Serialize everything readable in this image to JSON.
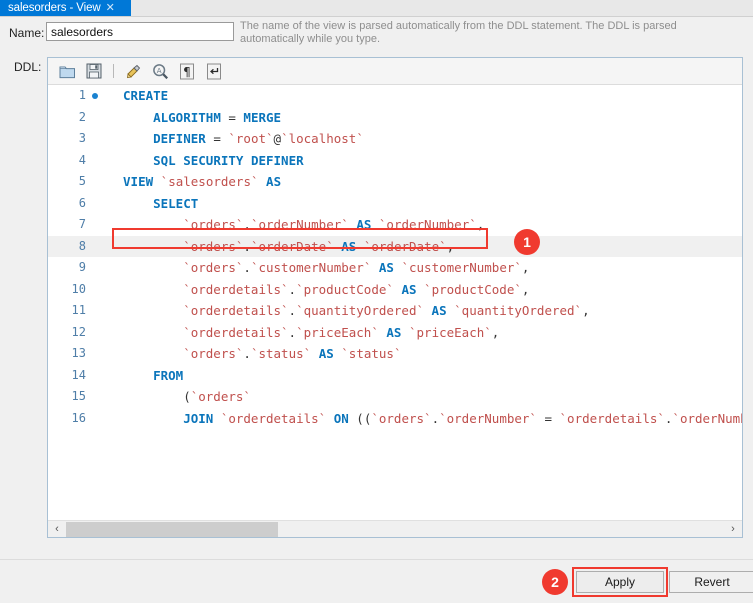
{
  "tab": {
    "label": "salesorders - View",
    "close_icon": "close-icon"
  },
  "name_row": {
    "label": "Name:",
    "value": "salesorders",
    "placeholder": "",
    "hint": "The name of the view is parsed automatically from the DDL statement. The DDL is parsed automatically while you type."
  },
  "ddl": {
    "label": "DDL:",
    "toolbar": [
      {
        "name": "open-folder-icon",
        "title": "Open"
      },
      {
        "name": "save-icon",
        "title": "Save"
      },
      {
        "name": "beautify-broom-icon",
        "title": "Beautify"
      },
      {
        "name": "find-icon",
        "title": "Find"
      },
      {
        "name": "show-invisible-chars-icon",
        "title": "Show Invisible Characters"
      },
      {
        "name": "toggle-wrapping-icon",
        "title": "Toggle Wrapping"
      }
    ],
    "highlighted_line": 8,
    "lines": [
      {
        "num": "1",
        "breakpoint": true,
        "indent": 2,
        "tokens": [
          {
            "t": "kw",
            "v": "CREATE"
          }
        ]
      },
      {
        "num": "2",
        "breakpoint": false,
        "indent": 6,
        "tokens": [
          {
            "t": "kw",
            "v": "ALGORITHM"
          },
          {
            "t": "pl",
            "v": " = "
          },
          {
            "t": "kw",
            "v": "MERGE"
          }
        ]
      },
      {
        "num": "3",
        "breakpoint": false,
        "indent": 6,
        "tokens": [
          {
            "t": "kw",
            "v": "DEFINER"
          },
          {
            "t": "pl",
            "v": " = "
          },
          {
            "t": "id",
            "v": "`root`"
          },
          {
            "t": "pl",
            "v": "@"
          },
          {
            "t": "id",
            "v": "`localhost`"
          }
        ]
      },
      {
        "num": "4",
        "breakpoint": false,
        "indent": 6,
        "tokens": [
          {
            "t": "kw",
            "v": "SQL SECURITY DEFINER"
          }
        ]
      },
      {
        "num": "5",
        "breakpoint": false,
        "indent": 2,
        "tokens": [
          {
            "t": "kw",
            "v": "VIEW"
          },
          {
            "t": "pl",
            "v": " "
          },
          {
            "t": "id",
            "v": "`salesorders`"
          },
          {
            "t": "pl",
            "v": " "
          },
          {
            "t": "kw",
            "v": "AS"
          }
        ]
      },
      {
        "num": "6",
        "breakpoint": false,
        "indent": 6,
        "tokens": [
          {
            "t": "kw",
            "v": "SELECT"
          }
        ]
      },
      {
        "num": "7",
        "breakpoint": false,
        "indent": 10,
        "tokens": [
          {
            "t": "id",
            "v": "`orders`"
          },
          {
            "t": "pl",
            "v": "."
          },
          {
            "t": "id",
            "v": "`orderNumber`"
          },
          {
            "t": "pl",
            "v": " "
          },
          {
            "t": "kw",
            "v": "AS"
          },
          {
            "t": "pl",
            "v": " "
          },
          {
            "t": "id",
            "v": "`orderNumber`"
          },
          {
            "t": "pl",
            "v": ","
          }
        ]
      },
      {
        "num": "8",
        "breakpoint": false,
        "indent": 10,
        "tokens": [
          {
            "t": "id",
            "v": "`orders`"
          },
          {
            "t": "pl",
            "v": "."
          },
          {
            "t": "id",
            "v": "`orderDate`"
          },
          {
            "t": "pl",
            "v": " "
          },
          {
            "t": "kw",
            "v": "AS"
          },
          {
            "t": "pl",
            "v": " "
          },
          {
            "t": "id",
            "v": "`orderDate`"
          },
          {
            "t": "pl",
            "v": ","
          }
        ]
      },
      {
        "num": "9",
        "breakpoint": false,
        "indent": 10,
        "tokens": [
          {
            "t": "id",
            "v": "`orders`"
          },
          {
            "t": "pl",
            "v": "."
          },
          {
            "t": "id",
            "v": "`customerNumber`"
          },
          {
            "t": "pl",
            "v": " "
          },
          {
            "t": "kw",
            "v": "AS"
          },
          {
            "t": "pl",
            "v": " "
          },
          {
            "t": "id",
            "v": "`customerNumber`"
          },
          {
            "t": "pl",
            "v": ","
          }
        ]
      },
      {
        "num": "10",
        "breakpoint": false,
        "indent": 10,
        "tokens": [
          {
            "t": "id",
            "v": "`orderdetails`"
          },
          {
            "t": "pl",
            "v": "."
          },
          {
            "t": "id",
            "v": "`productCode`"
          },
          {
            "t": "pl",
            "v": " "
          },
          {
            "t": "kw",
            "v": "AS"
          },
          {
            "t": "pl",
            "v": " "
          },
          {
            "t": "id",
            "v": "`productCode`"
          },
          {
            "t": "pl",
            "v": ","
          }
        ]
      },
      {
        "num": "11",
        "breakpoint": false,
        "indent": 10,
        "tokens": [
          {
            "t": "id",
            "v": "`orderdetails`"
          },
          {
            "t": "pl",
            "v": "."
          },
          {
            "t": "id",
            "v": "`quantityOrdered`"
          },
          {
            "t": "pl",
            "v": " "
          },
          {
            "t": "kw",
            "v": "AS"
          },
          {
            "t": "pl",
            "v": " "
          },
          {
            "t": "id",
            "v": "`quantityOrdered`"
          },
          {
            "t": "pl",
            "v": ","
          }
        ]
      },
      {
        "num": "12",
        "breakpoint": false,
        "indent": 10,
        "tokens": [
          {
            "t": "id",
            "v": "`orderdetails`"
          },
          {
            "t": "pl",
            "v": "."
          },
          {
            "t": "id",
            "v": "`priceEach`"
          },
          {
            "t": "pl",
            "v": " "
          },
          {
            "t": "kw",
            "v": "AS"
          },
          {
            "t": "pl",
            "v": " "
          },
          {
            "t": "id",
            "v": "`priceEach`"
          },
          {
            "t": "pl",
            "v": ","
          }
        ]
      },
      {
        "num": "13",
        "breakpoint": false,
        "indent": 10,
        "tokens": [
          {
            "t": "id",
            "v": "`orders`"
          },
          {
            "t": "pl",
            "v": "."
          },
          {
            "t": "id",
            "v": "`status`"
          },
          {
            "t": "pl",
            "v": " "
          },
          {
            "t": "kw",
            "v": "AS"
          },
          {
            "t": "pl",
            "v": " "
          },
          {
            "t": "id",
            "v": "`status`"
          }
        ]
      },
      {
        "num": "14",
        "breakpoint": false,
        "indent": 6,
        "tokens": [
          {
            "t": "kw",
            "v": "FROM"
          }
        ]
      },
      {
        "num": "15",
        "breakpoint": false,
        "indent": 10,
        "tokens": [
          {
            "t": "pl",
            "v": "("
          },
          {
            "t": "id",
            "v": "`orders`"
          }
        ]
      },
      {
        "num": "16",
        "breakpoint": false,
        "indent": 10,
        "tokens": [
          {
            "t": "kw",
            "v": "JOIN"
          },
          {
            "t": "pl",
            "v": " "
          },
          {
            "t": "id",
            "v": "`orderdetails`"
          },
          {
            "t": "pl",
            "v": " "
          },
          {
            "t": "kw",
            "v": "ON"
          },
          {
            "t": "pl",
            "v": " (("
          },
          {
            "t": "id",
            "v": "`orders`"
          },
          {
            "t": "pl",
            "v": "."
          },
          {
            "t": "id",
            "v": "`orderNumber`"
          },
          {
            "t": "pl",
            "v": " = "
          },
          {
            "t": "id",
            "v": "`orderdetails`"
          },
          {
            "t": "pl",
            "v": "."
          },
          {
            "t": "id",
            "v": "`orderNumber`"
          },
          {
            "t": "pl",
            "v": ")))"
          }
        ]
      }
    ],
    "scrollbar": {
      "left_arrow": "‹",
      "right_arrow": "›"
    }
  },
  "footer": {
    "apply_label": "Apply",
    "revert_label": "Revert"
  },
  "annotations": [
    {
      "badge": "1",
      "target": "orderDate-column-line"
    },
    {
      "badge": "2",
      "target": "apply-button"
    }
  ],
  "colors": {
    "tab_active": "#0078d7",
    "annotation_red": "#f03a2f",
    "keyword_blue": "#0b75bb",
    "identifier_red": "#c0504d",
    "line_number": "#4f7ea8"
  }
}
